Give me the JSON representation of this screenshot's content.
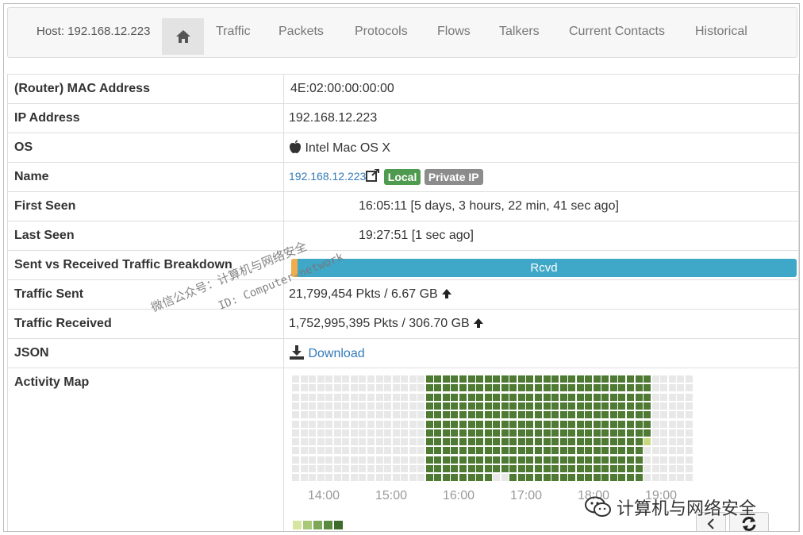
{
  "nav": {
    "host": "Host: 192.168.12.223",
    "items": [
      "Traffic",
      "Packets",
      "Protocols",
      "Flows",
      "Talkers",
      "Current Contacts",
      "Historical"
    ]
  },
  "rows": {
    "mac": {
      "label": "(Router) MAC Address",
      "value": "4E:02:00:00:00:00"
    },
    "ip": {
      "label": "IP Address",
      "value": "192.168.12.223"
    },
    "os": {
      "label": "OS",
      "value": "Intel Mac OS X"
    },
    "name": {
      "label": "Name",
      "link": "192.168.12.223",
      "badge_local": "Local",
      "badge_private": "Private IP"
    },
    "first_seen": {
      "label": "First Seen",
      "value": "16:05:11 [5 days, 3 hours, 22 min, 41 sec ago]"
    },
    "last_seen": {
      "label": "Last Seen",
      "value": "19:27:51 [1 sec ago]"
    },
    "breakdown": {
      "label": "Sent vs Received Traffic Breakdown",
      "rcvd_label": "Rcvd",
      "sent_fraction": 0.012
    },
    "traffic_sent": {
      "label": "Traffic Sent",
      "value": "21,799,454 Pkts / 6.67 GB"
    },
    "traffic_received": {
      "label": "Traffic Received",
      "value": "1,752,995,395 Pkts / 306.70 GB"
    },
    "json": {
      "label": "JSON",
      "link": "Download"
    },
    "activity": {
      "label": "Activity Map",
      "ticks": [
        "14:00",
        "15:00",
        "16:00",
        "17:00",
        "18:00",
        "19:00"
      ]
    }
  },
  "colors": {
    "active": "#4e7a34",
    "idle": "#e8e8e8",
    "light": "#c8d87f",
    "badge_local": "#4e9a4e",
    "bar": "#3fa7c7"
  },
  "watermark": {
    "line1": "微信公众号：计算机与网络安全",
    "line2": "ID: Computer-network",
    "brand": "计算机与网络安全"
  }
}
